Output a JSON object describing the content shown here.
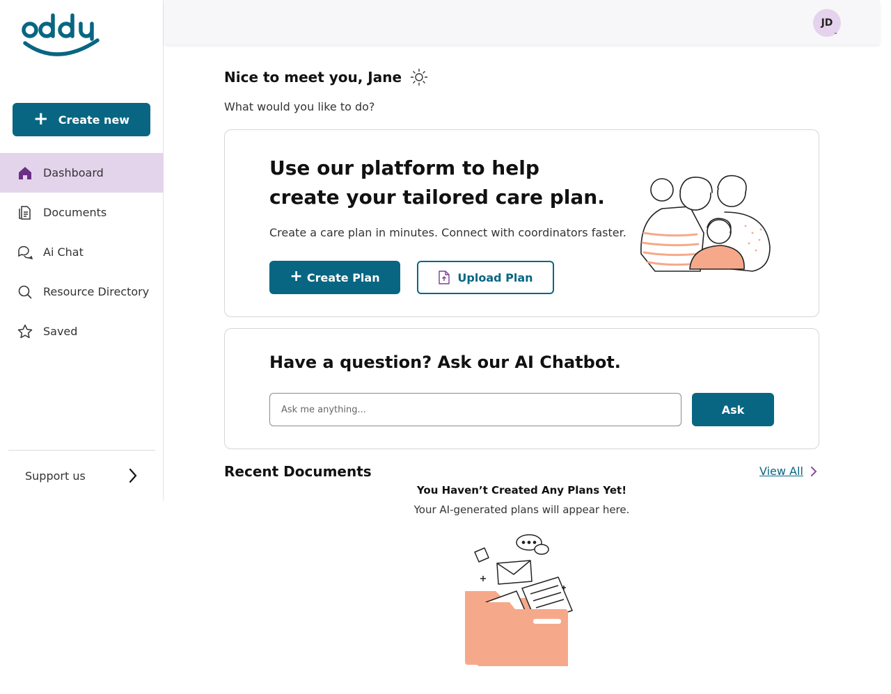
{
  "brand": {
    "logo_text": "oddy",
    "color": "#086682",
    "accent": "#e3d4ec"
  },
  "sidebar": {
    "create_label": "Create new",
    "items": [
      {
        "label": "Dashboard",
        "icon": "home-icon",
        "active": true
      },
      {
        "label": "Documents",
        "icon": "document-icon",
        "active": false
      },
      {
        "label": "Ai Chat",
        "icon": "chat-icon",
        "active": false
      },
      {
        "label": "Resource Directory",
        "icon": "search-icon",
        "active": false
      },
      {
        "label": "Saved",
        "icon": "star-icon",
        "active": false
      }
    ],
    "support_label": "Support us"
  },
  "header": {
    "avatar_initials": "JD"
  },
  "main": {
    "greeting": "Nice to meet you, Jane",
    "question": "What would you like to do?",
    "plan_card": {
      "headline_line1": "Use our platform to help",
      "headline_line2": "create your tailored care plan.",
      "subtext": "Create a care plan in minutes. Connect with coordinators faster.",
      "create_label": "Create Plan",
      "upload_label": "Upload Plan"
    },
    "chat_card": {
      "title": "Have a question? Ask our AI Chatbot.",
      "placeholder": "Ask me anything...",
      "ask_label": "Ask"
    },
    "recent": {
      "title": "Recent Documents",
      "view_all_label": "View All",
      "empty_title": "You Haven’t Created Any Plans Yet!",
      "empty_sub": "Your AI-generated plans will appear here."
    }
  }
}
